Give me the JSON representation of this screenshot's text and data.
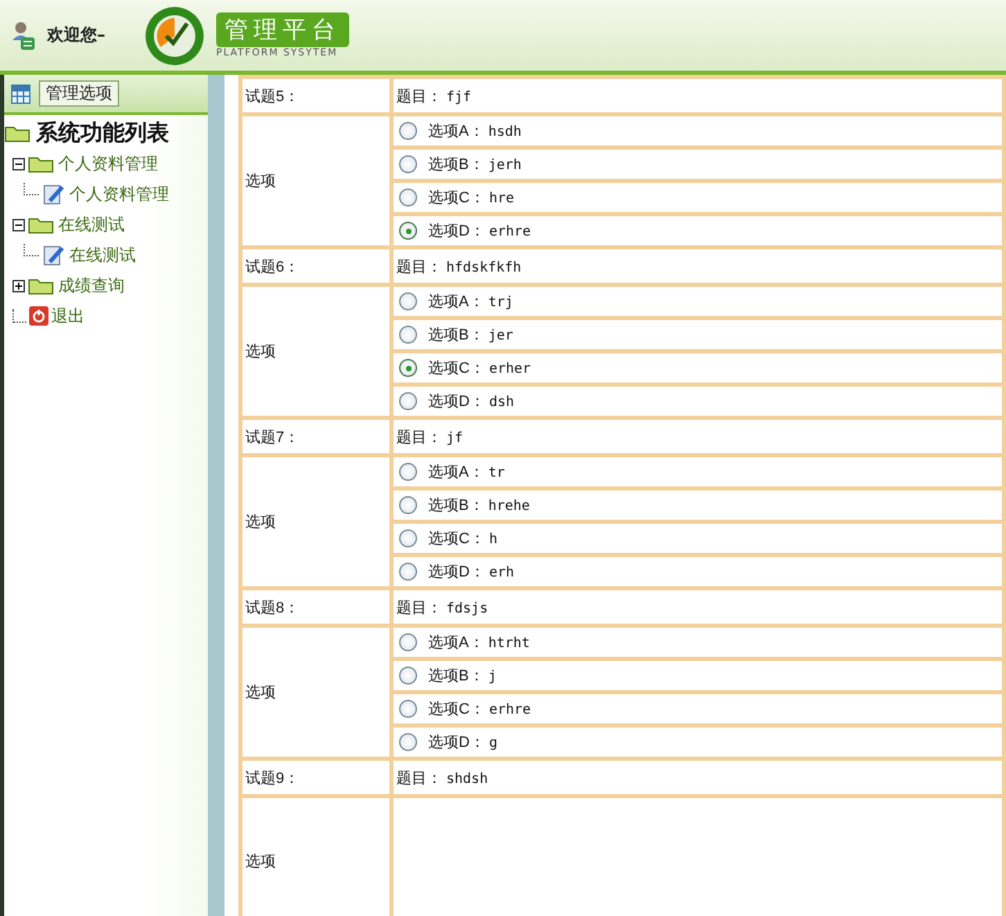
{
  "header": {
    "welcome": "欢迎您–",
    "logo_title": "管理平台",
    "logo_subtitle": "PLATFORM SYSYTEM"
  },
  "sidebar": {
    "button": "管理选项",
    "tree": {
      "label": "系统功能列表",
      "children": [
        {
          "label": "个人资料管理",
          "kind": "folder",
          "expanded": true,
          "children": [
            {
              "label": "个人资料管理",
              "kind": "page"
            }
          ]
        },
        {
          "label": "在线测试",
          "kind": "folder",
          "expanded": true,
          "children": [
            {
              "label": "在线测试",
              "kind": "page"
            }
          ]
        },
        {
          "label": "成绩查询",
          "kind": "folder",
          "expanded": false
        },
        {
          "label": "退出",
          "kind": "exit"
        }
      ]
    }
  },
  "questions": [
    {
      "number": "试题5：",
      "title_prefix": "题目：",
      "title": "fjf",
      "options_label": "选项",
      "options": [
        {
          "label": "选项A：",
          "text": "hsdh",
          "selected": false
        },
        {
          "label": "选项B：",
          "text": "jerh",
          "selected": false
        },
        {
          "label": "选项C：",
          "text": "hre",
          "selected": false
        },
        {
          "label": "选项D：",
          "text": "erhre",
          "selected": true
        }
      ]
    },
    {
      "number": "试题6：",
      "title_prefix": "题目：",
      "title": "hfdskfkfh",
      "options_label": "选项",
      "options": [
        {
          "label": "选项A：",
          "text": "trj",
          "selected": false
        },
        {
          "label": "选项B：",
          "text": "jer",
          "selected": false
        },
        {
          "label": "选项C：",
          "text": "erher",
          "selected": true
        },
        {
          "label": "选项D：",
          "text": "dsh",
          "selected": false
        }
      ]
    },
    {
      "number": "试题7：",
      "title_prefix": "题目：",
      "title": "jf",
      "options_label": "选项",
      "options": [
        {
          "label": "选项A：",
          "text": "tr",
          "selected": false
        },
        {
          "label": "选项B：",
          "text": "hrehe",
          "selected": false
        },
        {
          "label": "选项C：",
          "text": "h",
          "selected": false
        },
        {
          "label": "选项D：",
          "text": "erh",
          "selected": false
        }
      ]
    },
    {
      "number": "试题8：",
      "title_prefix": "题目：",
      "title": "fdsjs",
      "options_label": "选项",
      "options": [
        {
          "label": "选项A：",
          "text": "htrht",
          "selected": false
        },
        {
          "label": "选项B：",
          "text": "j",
          "selected": false
        },
        {
          "label": "选项C：",
          "text": "erhre",
          "selected": false
        },
        {
          "label": "选项D：",
          "text": "g",
          "selected": false
        }
      ]
    },
    {
      "number": "试题9：",
      "title_prefix": "题目：",
      "title": "shdsh",
      "options_label": "选项"
    }
  ]
}
